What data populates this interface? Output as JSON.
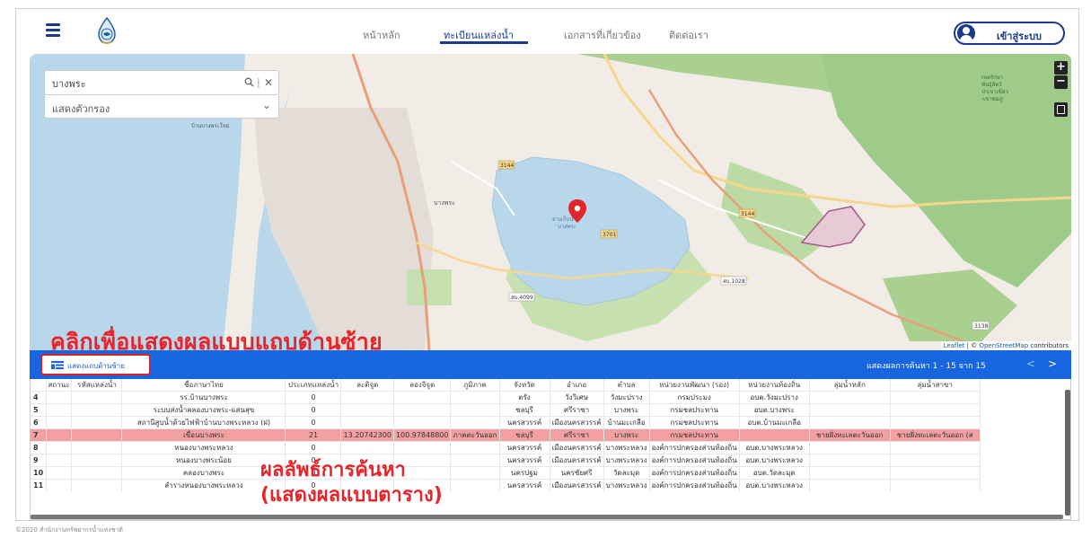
{
  "header": {
    "nav": [
      {
        "label": "หน้าหลัก"
      },
      {
        "label": "ทะเบียนแหล่งน้ำ"
      },
      {
        "label": "เอกสารที่เกี่ยวข้อง"
      },
      {
        "label": "ติดต่อเรา"
      }
    ],
    "active_nav": "ทะเบียนแหล่งน้ำ",
    "login_label": "เข้าสู่ระบบ"
  },
  "search": {
    "value": "บางพระ",
    "filter_label": "แสดงตัวกรอง"
  },
  "map": {
    "zoom_in": "+",
    "zoom_out": "−",
    "attribution_leaflet": "Leaflet",
    "attribution_sep": " | © ",
    "attribution_osm": "OpenStreetMap",
    "attribution_contrib": " contributors",
    "roads": [
      "3144",
      "3144",
      "3701",
      "สบ.4099",
      "สบ.1028",
      "3138"
    ],
    "water_label": [
      "อ่างเก็บน้ำ",
      "บางพระ"
    ],
    "forest_label": [
      "เขตรักษา",
      "พันธุ์สัตว์",
      "ป่าเขาเขียว",
      "-เขาชมภู่"
    ],
    "place_bangpra": "บางพระ",
    "place_top": "บ้านบางพระใหม่"
  },
  "annotations": {
    "left": "คลิกเพื่อแสดงผลแบบแถบด้านซ้าย",
    "result_line1": "ผลลัพธ์การค้นหา",
    "result_line2": "(แสดงผลแบบตาราง)"
  },
  "results_bar": {
    "side_toggle": "แสดงแถบด้านซ้าย",
    "info": "แสดงผลการค้นหา 1 - 15 จาก 15",
    "prev": "<",
    "next": ">"
  },
  "table": {
    "headers": [
      "",
      "สถานะ",
      "รหัสแหล่งน้ำ",
      "ชื่อภาษาไทย",
      "ประเภทแหล่งน้ำ",
      "ละติจูด",
      "ลองจิจูด",
      "ภูมิภาค",
      "จังหวัด",
      "อำเภอ",
      "ตำบล",
      "หน่วยงานพัฒนา (รอง)",
      "หน่วยงานท้องถิ่น",
      "ลุ่มน้ำหลัก",
      "ลุ่มน้ำสาขา"
    ],
    "rows": [
      [
        "4",
        "",
        "",
        "รร.บ้านบางพระ",
        "0",
        "",
        "",
        "",
        "ตรัง",
        "วังวิเศษ",
        "วังมะปราง",
        "กรมประมง",
        "อบต.วังมะปราง",
        "",
        ""
      ],
      [
        "5",
        "",
        "",
        "ระบบส่งน้ำคลองบางพระ-แสนสุข",
        "0",
        "",
        "",
        "",
        "ชลบุรี",
        "ศรีราชา",
        "บางพระ",
        "กรมชลประทาน",
        "อบต.บางพระ",
        "",
        ""
      ],
      [
        "6",
        "",
        "",
        "สถานีสูบน้ำด้วยไฟฟ้าบ้านบางพระหลวง (ฝ)",
        "0",
        "",
        "",
        "",
        "นครสวรรค์",
        "เมืองนครสวรรค์",
        "บ้านมะเกลือ",
        "กรมชลประทาน",
        "อบต.บ้านมะเกลือ",
        "",
        ""
      ],
      [
        "7",
        "",
        "",
        "เขื่อนบางพระ",
        "21",
        "13.20742300",
        "100.97848800",
        "ภาคตะวันออก",
        "ชลบุรี",
        "ศรีราชา",
        "บางพระ",
        "กรมชลประทาน",
        "",
        "ชายฝั่งทะเลตะวันออก",
        "ชายฝั่งทะเลตะวันออก (ส"
      ],
      [
        "8",
        "",
        "",
        "หนองบางพระหลวง",
        "0",
        "",
        "",
        "",
        "นครสวรรค์",
        "เมืองนครสวรรค์",
        "บางพระหลวง",
        "องค์การปกครองส่วนท้องถิ่น",
        "อบต.บางพระหลวง",
        "",
        ""
      ],
      [
        "9",
        "",
        "",
        "หนองบางพระน้อย",
        "0",
        "",
        "",
        "",
        "นครสวรรค์",
        "เมืองนครสวรรค์",
        "บางพระหลวง",
        "องค์การปกครองส่วนท้องถิ่น",
        "อบต.บางพระหลวง",
        "",
        ""
      ],
      [
        "10",
        "",
        "",
        "คลองบางพระ",
        "0",
        "",
        "",
        "",
        "นครปฐม",
        "นครชัยศรี",
        "วัดละมุด",
        "องค์การปกครองส่วนท้องถิ่น",
        "อบต.วัดละมุด",
        "",
        ""
      ],
      [
        "11",
        "",
        "",
        "สำรางหนองบางพระหลวง",
        "0",
        "",
        "",
        "",
        "นครสวรรค์",
        "เมืองนครสวรรค์",
        "บางพระหลวง",
        "องค์การปกครองส่วนท้องถิ่น",
        "อบต.บางพระหลวง",
        "",
        ""
      ]
    ],
    "highlight_row": 3
  },
  "footer": "©2020 สำนักงานทรัพยากรน้ำแห่งชาติ",
  "colors": {
    "primary": "#1a3a8f",
    "bar_blue": "#1766e0",
    "annotation_red": "#e8242a",
    "highlight_row": "#f2a0a0",
    "water": "#b8d7eb",
    "forest": "#9ecb8a"
  },
  "icons": [
    "menu-icon",
    "logo-emblem",
    "user-avatar-icon",
    "search-icon",
    "close-icon",
    "chevron-down-icon",
    "layers-icon",
    "map-marker-icon",
    "sidebar-list-icon"
  ]
}
